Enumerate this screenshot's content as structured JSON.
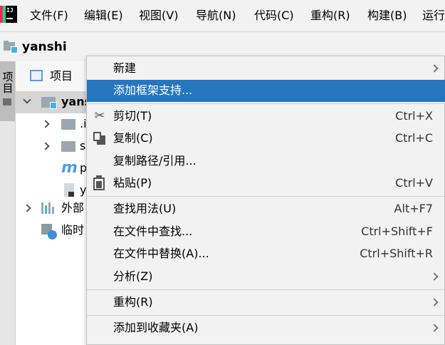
{
  "menubar": {
    "logo_text": "IJ",
    "items": [
      {
        "label": "文件(F)"
      },
      {
        "label": "编辑(E)"
      },
      {
        "label": "视图(V)"
      },
      {
        "label": "导航(N)"
      },
      {
        "label": "代码(C)"
      },
      {
        "label": "重构(R)"
      },
      {
        "label": "构建(B)"
      },
      {
        "label": "运行"
      }
    ]
  },
  "navbar": {
    "project_name": "yanshi",
    "icon": "project-folder-icon"
  },
  "sidebar": {
    "tab_label": "项目"
  },
  "project_panel": {
    "header_label": "项目",
    "tree": [
      {
        "label": "yans",
        "icon": "project-folder-icon",
        "expanded": true,
        "selected": true
      },
      {
        "label": ".i",
        "icon": "folder-icon",
        "expanded": false
      },
      {
        "label": "s",
        "icon": "folder-icon",
        "expanded": false
      },
      {
        "label": "p",
        "icon": "maven-m-icon"
      },
      {
        "label": "y",
        "icon": "module-file-icon"
      },
      {
        "label": "外部",
        "icon": "libraries-icon",
        "expanded": false
      },
      {
        "label": "临时",
        "icon": "scratches-icon"
      }
    ]
  },
  "context_menu": {
    "items": [
      {
        "label": "新建",
        "submenu": true
      },
      {
        "label": "添加框架支持...",
        "active": true
      },
      {
        "label": "剪切(T)",
        "shortcut": "Ctrl+X",
        "icon": "scissors-icon"
      },
      {
        "label": "复制(C)",
        "shortcut": "Ctrl+C",
        "icon": "copy-icon"
      },
      {
        "label": "复制路径/引用..."
      },
      {
        "label": "粘贴(P)",
        "shortcut": "Ctrl+V",
        "icon": "paste-icon"
      },
      {
        "label": "查找用法(U)",
        "shortcut": "Alt+F7"
      },
      {
        "label": "在文件中查找...",
        "shortcut": "Ctrl+Shift+F"
      },
      {
        "label": "在文件中替换(A)...",
        "shortcut": "Ctrl+Shift+R"
      },
      {
        "label": "分析(Z)",
        "submenu": true
      },
      {
        "label": "重构(R)",
        "submenu": true
      },
      {
        "label": "添加到收藏夹(A)",
        "submenu": true
      }
    ]
  },
  "colors": {
    "selection": "#2675bf",
    "tree_selection": "#d5d5d5",
    "accent_blue": "#40b6e0"
  }
}
